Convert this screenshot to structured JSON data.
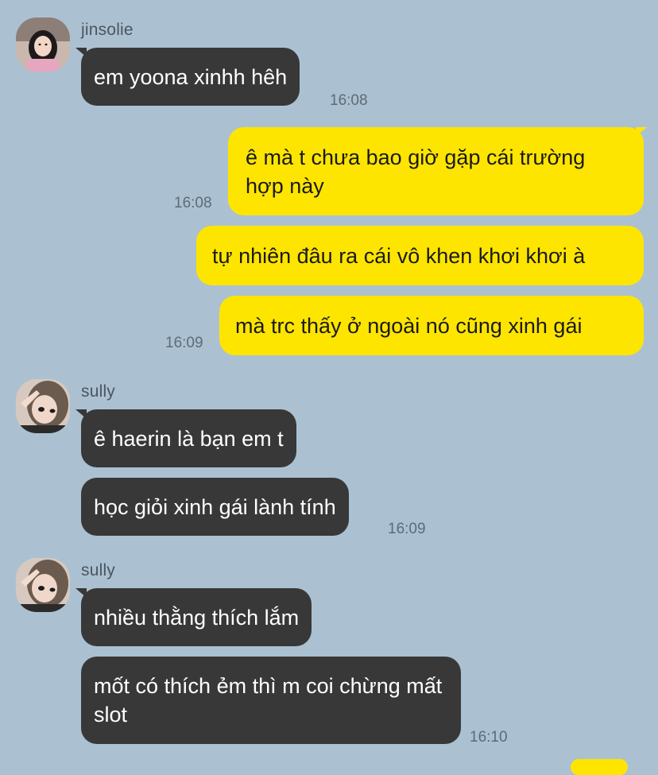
{
  "messages": [
    {
      "sender": "jinsolie",
      "text": "em yoona xinhh hêh",
      "time": "16:08"
    },
    {
      "text": "ê mà t chưa bao giờ gặp cái trường hợp này",
      "time": "16:08"
    },
    {
      "text": "tự nhiên đâu ra cái vô khen khơi khơi à"
    },
    {
      "text": "mà trc thấy ở ngoài nó cũng xinh gái",
      "time": "16:09"
    },
    {
      "sender": "sully",
      "text": "ê haerin là bạn em t"
    },
    {
      "text": "học giỏi xinh gái lành tính",
      "time": "16:09"
    },
    {
      "sender": "sully",
      "text": "nhiều thằng thích lắm"
    },
    {
      "text": "mốt có thích ẻm thì m coi chừng mất slot",
      "time": "16:10"
    }
  ],
  "colors": {
    "background": "#abc1d1",
    "incoming_bubble": "#383838",
    "outgoing_bubble": "#fee500"
  }
}
